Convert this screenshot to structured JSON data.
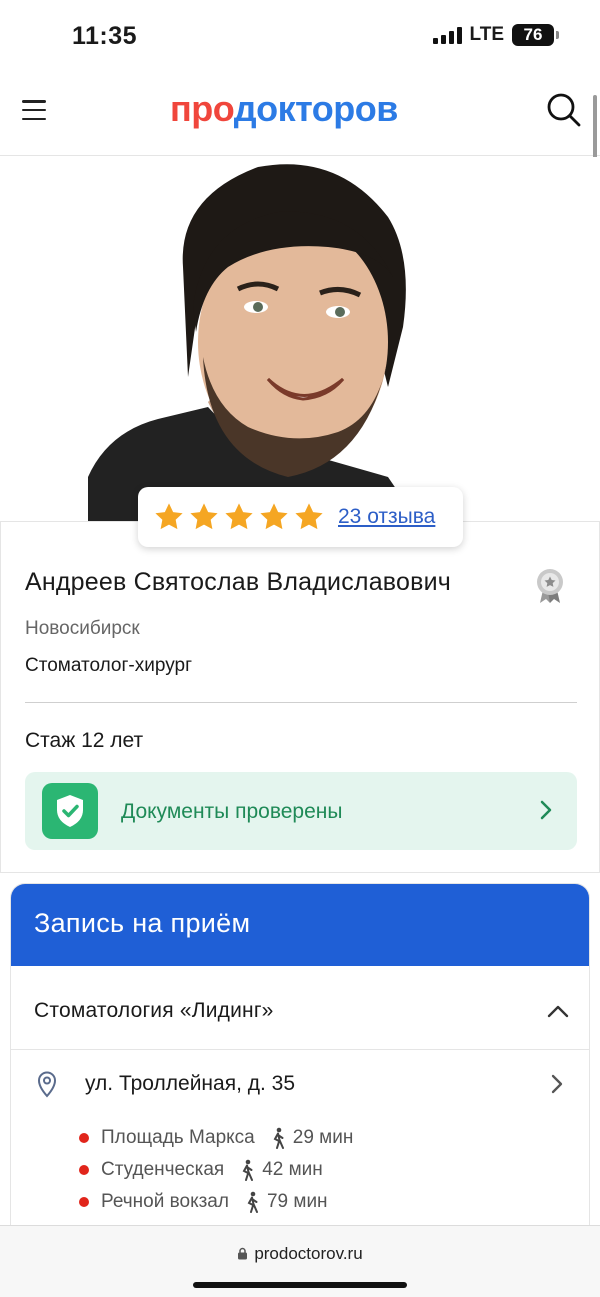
{
  "status_bar": {
    "time": "11:35",
    "network": "LTE",
    "battery": "76"
  },
  "header": {
    "logo_part1": "про",
    "logo_part2": "докторов",
    "menu_icon": "menu-icon",
    "search_icon": "search-icon"
  },
  "rating": {
    "stars": 5,
    "reviews_label": "23 отзыва",
    "star_color": "#f5a623"
  },
  "doctor": {
    "name": "Андреев Святослав Владиславович",
    "city": "Новосибирск",
    "specialty": "Стоматолог-хирург",
    "experience": "Стаж 12 лет",
    "documents_label": "Документы проверены"
  },
  "appointment": {
    "title": "Запись на приём",
    "clinic": "Стоматология «Лидинг»",
    "address": "ул. Троллейная, д. 35",
    "metro": [
      {
        "station": "Площадь Маркса",
        "walk": "29 мин"
      },
      {
        "station": "Студенческая",
        "walk": "42 мин"
      },
      {
        "station": "Речной вокзал",
        "walk": "79 мин"
      }
    ]
  },
  "browser": {
    "url": "prodoctorov.ru"
  },
  "colors": {
    "brand_red": "#f0463c",
    "brand_blue": "#2c7be5",
    "appt_blue": "#1f5fd6",
    "verified_green": "#2bb673",
    "metro_red": "#e1251b"
  }
}
